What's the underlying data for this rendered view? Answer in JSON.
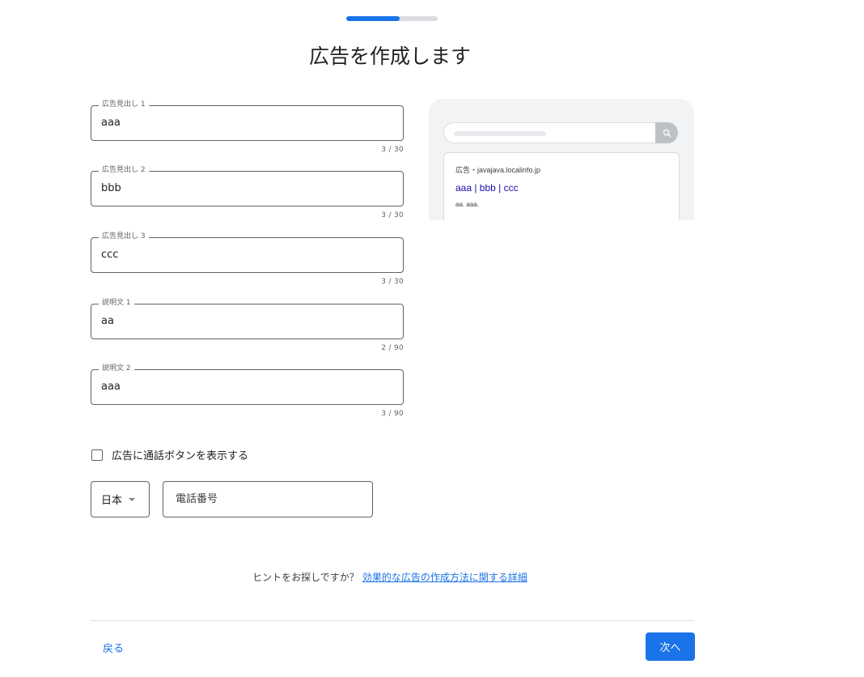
{
  "progress": {
    "fraction": 0.58,
    "accent": "#1a73e8",
    "track": "#dadce0"
  },
  "page_title": "広告を作成します",
  "fields": [
    {
      "label": "広告見出し 1",
      "value": "aaa",
      "counter": "3 / 30"
    },
    {
      "label": "広告見出し 2",
      "value": "bbb",
      "counter": "3 / 30"
    },
    {
      "label": "広告見出し 3",
      "value": "ccc",
      "counter": "3 / 30"
    },
    {
      "label": "説明文 1",
      "value": "aa",
      "counter": "2 / 90"
    },
    {
      "label": "説明文 2",
      "value": "aaa",
      "counter": "3 / 90"
    }
  ],
  "preview": {
    "search_icon": "search-icon",
    "url_line": "広告・javajava.localinfo.jp",
    "headline": "aaa | bbb | ccc",
    "description": "aa. aaa."
  },
  "call_button": {
    "label": "広告に通話ボタンを表示する",
    "checked": false
  },
  "country": {
    "selected": "日本",
    "icon": "chevron-down-icon"
  },
  "phone": {
    "placeholder": "電話番号",
    "value": ""
  },
  "hint": {
    "text": "ヒントをお探しですか？",
    "link_text": "効果的な広告の作成方法に関する詳細"
  },
  "footer": {
    "back_label": "戻る",
    "next_label": "次へ"
  }
}
